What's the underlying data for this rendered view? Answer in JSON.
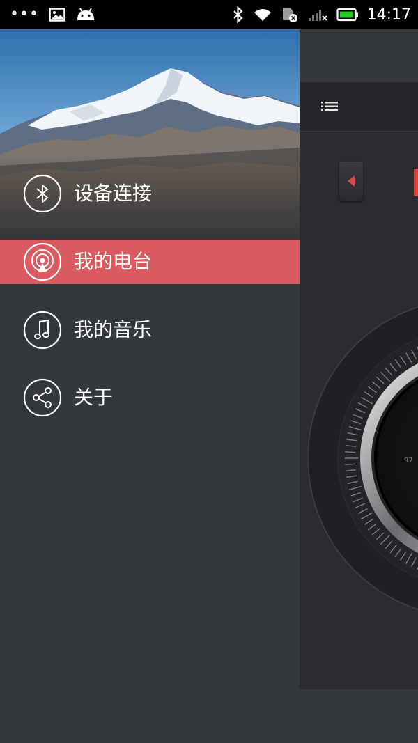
{
  "status_bar": {
    "time": "14:17",
    "left_icons": [
      "more-dots-icon",
      "image-icon",
      "android-icon"
    ],
    "right_icons": [
      "bluetooth-icon",
      "wifi-icon",
      "sim-missing-icon",
      "signal-icon",
      "battery-icon"
    ]
  },
  "drawer": {
    "items": [
      {
        "label": "设备连接",
        "icon": "bluetooth-icon",
        "active": false
      },
      {
        "label": "我的电台",
        "icon": "radio-icon",
        "active": true
      },
      {
        "label": "我的音乐",
        "icon": "music-note-icon",
        "active": false
      },
      {
        "label": "关于",
        "icon": "share-icon",
        "active": false
      }
    ]
  },
  "radio_screen": {
    "dial_tick_label": "97"
  },
  "colors": {
    "drawer_bg": "#34373b",
    "active_item_bg": "#d95b60",
    "accent_red": "#d9433e",
    "status_bar_bg": "#000000"
  }
}
